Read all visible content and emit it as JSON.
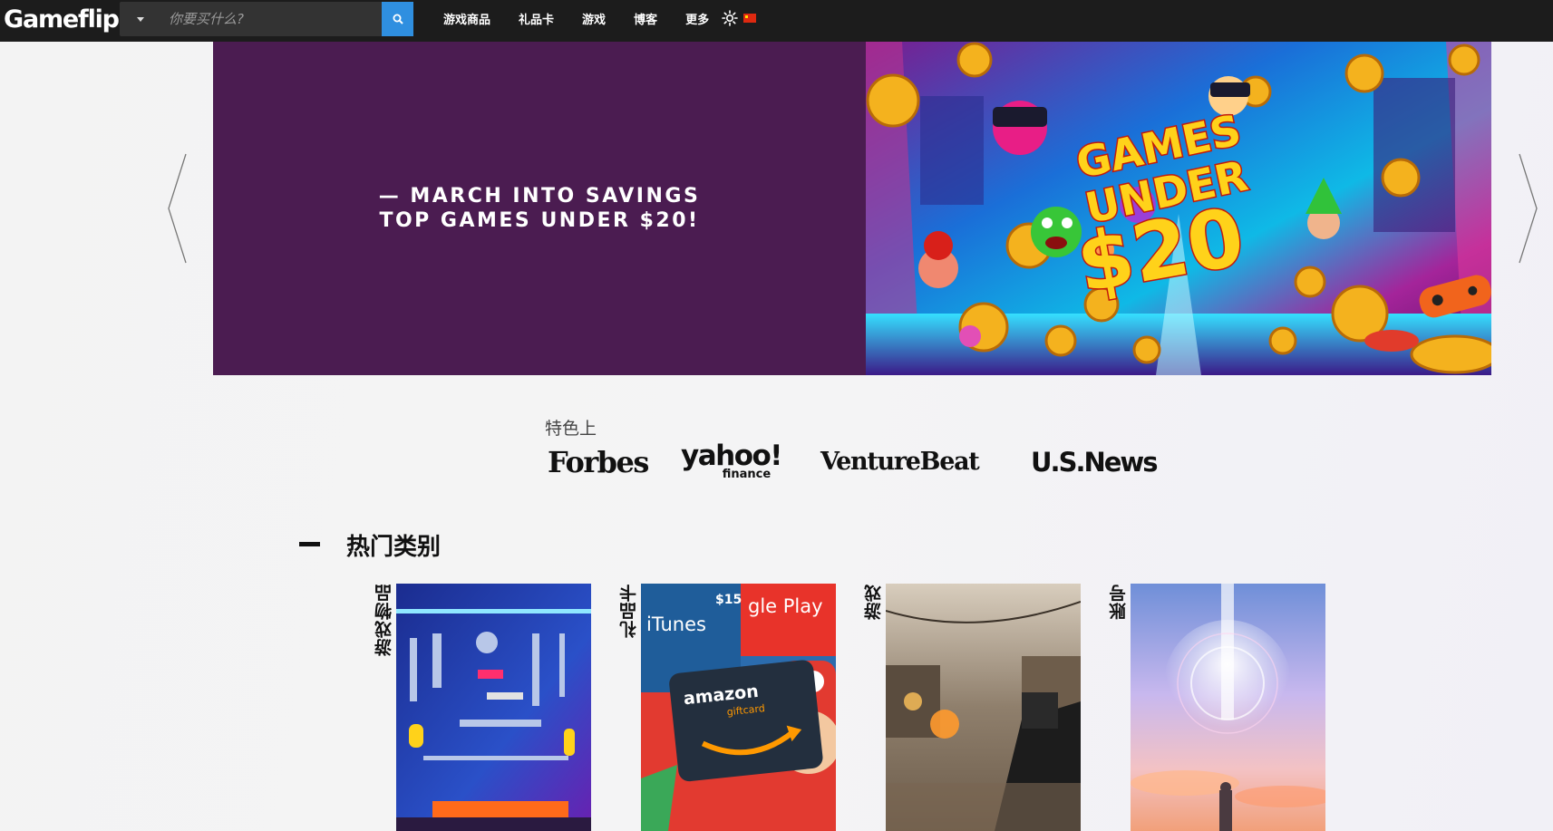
{
  "header": {
    "logo": "Gameflip",
    "search": {
      "placeholder": "你要买什么?"
    },
    "nav": [
      {
        "label": "游戏商品"
      },
      {
        "label": "礼品卡"
      },
      {
        "label": "游戏"
      },
      {
        "label": "博客"
      },
      {
        "label": "更多"
      }
    ],
    "theme_icon": "sun-icon",
    "language_flag": "cn-flag"
  },
  "hero": {
    "line1": "— MARCH INTO SAVINGS",
    "line2": "TOP GAMES UNDER $20!",
    "art_line1": "GAMES",
    "art_line2": "UNDER",
    "art_line3": "$20",
    "bg_color": "#4b1c51"
  },
  "featured": {
    "label": "特色上",
    "logos": {
      "forbes": "Forbes",
      "yahoo_main": "yahoo!",
      "yahoo_sub": "finance",
      "venturebeat": "VentureBeat",
      "usnews": "U.S.News"
    }
  },
  "categories": {
    "title": "热门类别",
    "items": [
      {
        "label": "游戏物品"
      },
      {
        "label": "礼品卡"
      },
      {
        "label": "游戏"
      },
      {
        "label": "账号"
      }
    ]
  },
  "gift_art": {
    "price": "$15",
    "itunes": "iTunes",
    "gplay": "gle Play",
    "amazon": "amazon",
    "giftcard": "giftcard"
  },
  "colors": {
    "topbar": "#1c1c1c",
    "search_button": "#2f8fe0",
    "hero_bg": "#4b1c51"
  }
}
